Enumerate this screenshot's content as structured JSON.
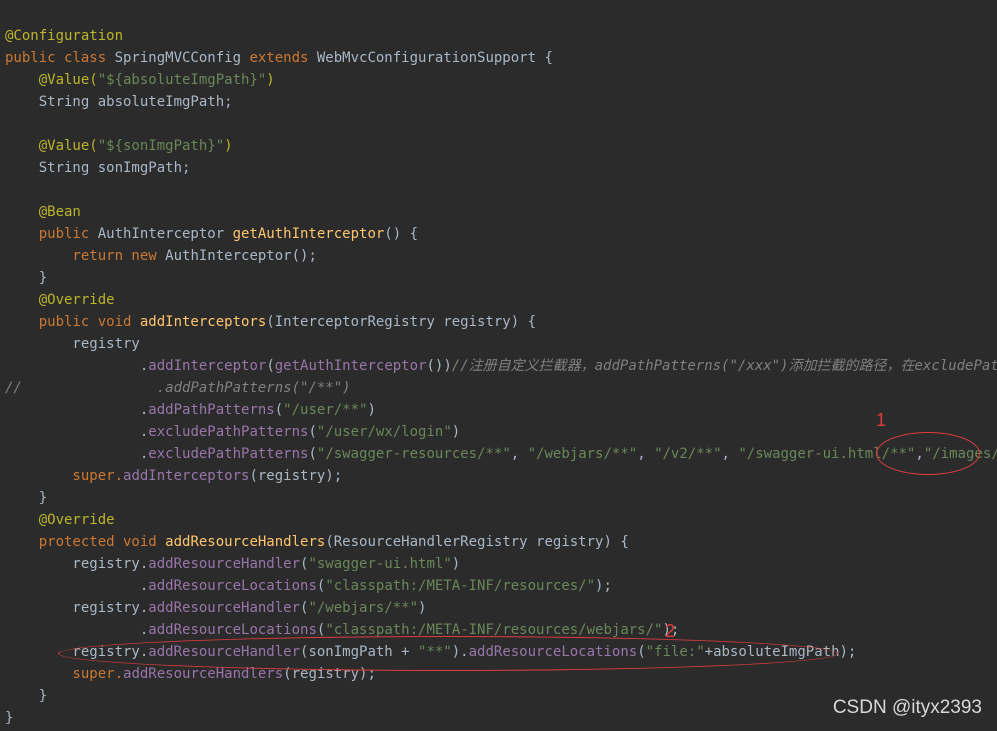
{
  "editor": {
    "theme_colors": {
      "background": "#2b2b2b",
      "plain": "#a9b7c6",
      "keyword": "#cc7832",
      "annotation": "#bbb529",
      "string": "#6a8759",
      "function": "#ffc66d",
      "method_call": "#9876aa",
      "comment": "#808080"
    },
    "lines": [
      [
        {
          "t": "@Configuration",
          "c": "ann"
        }
      ],
      [
        {
          "t": "public class ",
          "c": "kw"
        },
        {
          "t": "SpringMVCConfig ",
          "c": "plain"
        },
        {
          "t": "extends ",
          "c": "kw"
        },
        {
          "t": "WebMvcConfigurationSupport {",
          "c": "plain"
        }
      ],
      [
        {
          "t": "    @Value(",
          "c": "ann"
        },
        {
          "t": "\"${absoluteImgPath}\"",
          "c": "str"
        },
        {
          "t": ")",
          "c": "ann"
        }
      ],
      [
        {
          "t": "    String absoluteImgPath;",
          "c": "plain"
        }
      ],
      [],
      [
        {
          "t": "    @Value(",
          "c": "ann"
        },
        {
          "t": "\"${sonImgPath}\"",
          "c": "str"
        },
        {
          "t": ")",
          "c": "ann"
        }
      ],
      [
        {
          "t": "    String sonImgPath;",
          "c": "plain"
        }
      ],
      [],
      [
        {
          "t": "    @Bean",
          "c": "ann"
        }
      ],
      [
        {
          "t": "    public ",
          "c": "kw"
        },
        {
          "t": "AuthInterceptor ",
          "c": "plain"
        },
        {
          "t": "getAuthInterceptor",
          "c": "fn"
        },
        {
          "t": "() {",
          "c": "plain"
        }
      ],
      [
        {
          "t": "        return new ",
          "c": "kw"
        },
        {
          "t": "AuthInterceptor();",
          "c": "plain"
        }
      ],
      [
        {
          "t": "    }",
          "c": "plain"
        }
      ],
      [
        {
          "t": "    @Override",
          "c": "ann"
        }
      ],
      [
        {
          "t": "    public void ",
          "c": "kw"
        },
        {
          "t": "addInterceptors",
          "c": "fn"
        },
        {
          "t": "(InterceptorRegistry registry) {",
          "c": "plain"
        }
      ],
      [
        {
          "t": "        registry",
          "c": "plain"
        }
      ],
      [
        {
          "t": "                .",
          "c": "plain"
        },
        {
          "t": "addInterceptor",
          "c": "method"
        },
        {
          "t": "(",
          "c": "plain"
        },
        {
          "t": "getAuthInterceptor",
          "c": "method"
        },
        {
          "t": "())",
          "c": "plain"
        },
        {
          "t": "//注册自定义拦截器，addPathPatterns(\"/xxx\")添加拦截的路径，在excludePathPatt",
          "c": "cm"
        }
      ],
      [
        {
          "t": "//                .addPathPatterns(\"/**\")",
          "c": "cm"
        }
      ],
      [
        {
          "t": "                .",
          "c": "plain"
        },
        {
          "t": "addPathPatterns",
          "c": "method"
        },
        {
          "t": "(",
          "c": "plain"
        },
        {
          "t": "\"/user/**\"",
          "c": "str"
        },
        {
          "t": ")",
          "c": "plain"
        }
      ],
      [
        {
          "t": "                .",
          "c": "plain"
        },
        {
          "t": "excludePathPatterns",
          "c": "method"
        },
        {
          "t": "(",
          "c": "plain"
        },
        {
          "t": "\"/user/wx/login\"",
          "c": "str"
        },
        {
          "t": ")",
          "c": "plain"
        }
      ],
      [
        {
          "t": "                .",
          "c": "plain"
        },
        {
          "t": "excludePathPatterns",
          "c": "method"
        },
        {
          "t": "(",
          "c": "plain"
        },
        {
          "t": "\"/swagger-resources/**\"",
          "c": "str"
        },
        {
          "t": ", ",
          "c": "plain"
        },
        {
          "t": "\"/webjars/**\"",
          "c": "str"
        },
        {
          "t": ", ",
          "c": "plain"
        },
        {
          "t": "\"/v2/**\"",
          "c": "str"
        },
        {
          "t": ", ",
          "c": "plain"
        },
        {
          "t": "\"/swagger-ui.html/**\"",
          "c": "str"
        },
        {
          "t": ",",
          "c": "plain"
        },
        {
          "t": "\"/images/**\"",
          "c": "str"
        },
        {
          "t": ");",
          "c": "plain"
        }
      ],
      [
        {
          "t": "        super.",
          "c": "kw"
        },
        {
          "t": "addInterceptors",
          "c": "method"
        },
        {
          "t": "(registry);",
          "c": "plain"
        }
      ],
      [
        {
          "t": "    }",
          "c": "plain"
        }
      ],
      [
        {
          "t": "    @Override",
          "c": "ann"
        }
      ],
      [
        {
          "t": "    protected void ",
          "c": "kw"
        },
        {
          "t": "addResourceHandlers",
          "c": "fn"
        },
        {
          "t": "(ResourceHandlerRegistry registry) {",
          "c": "plain"
        }
      ],
      [
        {
          "t": "        registry.",
          "c": "plain"
        },
        {
          "t": "addResourceHandler",
          "c": "method"
        },
        {
          "t": "(",
          "c": "plain"
        },
        {
          "t": "\"swagger-ui.html\"",
          "c": "str"
        },
        {
          "t": ")",
          "c": "plain"
        }
      ],
      [
        {
          "t": "                .",
          "c": "plain"
        },
        {
          "t": "addResourceLocations",
          "c": "method"
        },
        {
          "t": "(",
          "c": "plain"
        },
        {
          "t": "\"classpath:/META-INF/resources/\"",
          "c": "str"
        },
        {
          "t": ");",
          "c": "plain"
        }
      ],
      [
        {
          "t": "        registry.",
          "c": "plain"
        },
        {
          "t": "addResourceHandler",
          "c": "method"
        },
        {
          "t": "(",
          "c": "plain"
        },
        {
          "t": "\"/webjars/**\"",
          "c": "str"
        },
        {
          "t": ")",
          "c": "plain"
        }
      ],
      [
        {
          "t": "                .",
          "c": "plain"
        },
        {
          "t": "addResourceLocations",
          "c": "method"
        },
        {
          "t": "(",
          "c": "plain"
        },
        {
          "t": "\"classpath:/META-INF/resources/webjars/\"",
          "c": "str"
        },
        {
          "t": ");",
          "c": "plain"
        }
      ],
      [
        {
          "t": "        registry.",
          "c": "plain"
        },
        {
          "t": "addResourceHandler",
          "c": "method"
        },
        {
          "t": "(sonImgPath + ",
          "c": "plain"
        },
        {
          "t": "\"**\"",
          "c": "str"
        },
        {
          "t": ").",
          "c": "plain"
        },
        {
          "t": "addResourceLocations",
          "c": "method"
        },
        {
          "t": "(",
          "c": "plain"
        },
        {
          "t": "\"file:\"",
          "c": "str"
        },
        {
          "t": "+absoluteImgPath);",
          "c": "plain"
        }
      ],
      [
        {
          "t": "        super.",
          "c": "kw"
        },
        {
          "t": "addResourceHandlers",
          "c": "method"
        },
        {
          "t": "(registry);",
          "c": "plain"
        }
      ],
      [
        {
          "t": "    }",
          "c": "plain"
        }
      ],
      [
        {
          "t": "}",
          "c": "plain"
        }
      ]
    ]
  },
  "annotations": {
    "marker_1_label": "1",
    "marker_2_label": "2",
    "marker_color": "#e03c3c"
  },
  "watermark": "CSDN @ityx2393"
}
